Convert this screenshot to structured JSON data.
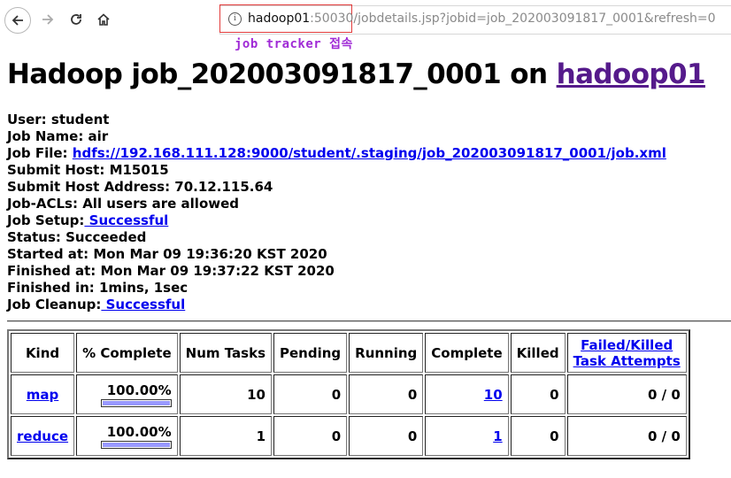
{
  "browser": {
    "url_host": "hadoop01",
    "url_rest": ":50030/jobdetails.jsp?jobid=job_202003091817_0001&refresh=0",
    "annotation": "job tracker 접속"
  },
  "page": {
    "title_prefix": "Hadoop job_202003091817_0001 on ",
    "title_link": "hadoop01"
  },
  "details": {
    "user_label": "User: ",
    "user": "student",
    "jobname_label": "Job Name: ",
    "jobname": "air",
    "jobfile_label": "Job File: ",
    "jobfile": "hdfs://192.168.111.128:9000/student/.staging/job_202003091817_0001/job.xml",
    "submithost_label": "Submit Host: ",
    "submithost": "M15015",
    "submitaddr_label": "Submit Host Address: ",
    "submitaddr": "70.12.115.64",
    "acls_label": "Job-ACLs: ",
    "acls": "All users are allowed",
    "setup_label": "Job Setup:",
    "setup": " Successful",
    "status_label": "Status: ",
    "status": "Succeeded",
    "started_label": "Started at: ",
    "started": "Mon Mar 09 19:36:20 KST 2020",
    "finished_label": "Finished at: ",
    "finished": "Mon Mar 09 19:37:22 KST 2020",
    "finishedin_label": "Finished in: ",
    "finishedin": "1mins, 1sec",
    "cleanup_label": "Job Cleanup:",
    "cleanup": " Successful"
  },
  "table": {
    "headers": [
      "Kind",
      "% Complete",
      "Num Tasks",
      "Pending",
      "Running",
      "Complete",
      "Killed",
      "Failed/Killed",
      "Task Attempts"
    ],
    "rows": [
      {
        "kind": "map",
        "pct": "100.00%",
        "pct_value": 1.0,
        "num": "10",
        "pending": "0",
        "running": "0",
        "complete": "10",
        "killed": "0",
        "failed": "0 / 0"
      },
      {
        "kind": "reduce",
        "pct": "100.00%",
        "pct_value": 1.0,
        "num": "1",
        "pending": "0",
        "running": "0",
        "complete": "1",
        "killed": "0",
        "failed": "0 / 0"
      }
    ]
  }
}
